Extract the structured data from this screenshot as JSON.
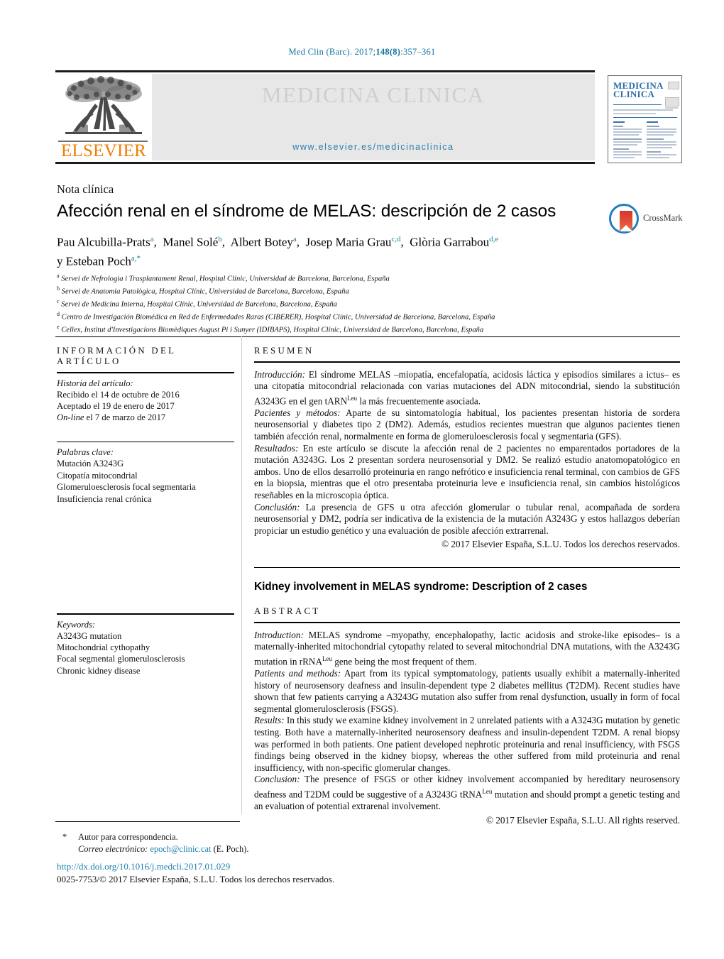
{
  "running_head": {
    "prefix": "Med Clin (Barc). 2017;",
    "volume_issue": "148(8)",
    "suffix": ":357–361"
  },
  "masthead": {
    "publisher": "ELSEVIER",
    "journal_title": "MEDICINA CLINICA",
    "journal_url": "www.elsevier.es/medicinaclinica",
    "cover_masthead_line1": "MEDICINA",
    "cover_masthead_line2": "CLINICA"
  },
  "article": {
    "type": "Nota clínica",
    "title": "Afección renal en el síndrome de MELAS: descripción de 2 casos",
    "crossmark_label": "CrossMark",
    "authors_line1_parts": [
      {
        "name": "Pau Alcubilla-Prats",
        "sup": "a"
      },
      {
        "name": "Manel Solé",
        "sup": "b"
      },
      {
        "name": "Albert Botey",
        "sup": "a"
      },
      {
        "name": "Josep Maria Grau",
        "sup": "c,d"
      },
      {
        "name": "Glòria Garrabou",
        "sup": "d,e"
      }
    ],
    "authors_line2": {
      "prefix": "y ",
      "name": "Esteban Poch",
      "sup": "a,*"
    },
    "affiliations": [
      {
        "marker": "a",
        "text": "Servei de Nefrologia i Trasplantament Renal, Hospital Clínic, Universidad de Barcelona, Barcelona, España"
      },
      {
        "marker": "b",
        "text": "Servei de Anatomia Patològica, Hospital Clínic, Universidad de Barcelona, Barcelona, España"
      },
      {
        "marker": "c",
        "text": "Servei de Medicina Interna, Hospital Clínic, Universidad de Barcelona, Barcelona, España"
      },
      {
        "marker": "d",
        "text": "Centro de Investigación Biomédica en Red de Enfermedades Raras (CIBERER), Hospital Clínic, Universidad de Barcelona, Barcelona, España"
      },
      {
        "marker": "e",
        "text": "Cellex, Institut d'Investigacions Biomèdiques August Pi i Sunyer (IDIBAPS), Hospital Clínic, Universidad de Barcelona, Barcelona, España"
      }
    ]
  },
  "info_column": {
    "heading": "INFORMACIÓN DEL ARTÍCULO",
    "history_label": "Historia del artículo:",
    "history": [
      "Recibido el 14 de octubre de 2016",
      "Aceptado el 19 de enero de 2017",
      "On-line el 7 de marzo de 2017"
    ],
    "history_online_italic": "On-line",
    "history_online_rest": " el 7 de marzo de 2017",
    "keywords_label": "Palabras clave:",
    "keywords": [
      "Mutación A3243G",
      "Citopatía mitocondrial",
      "Glomeruloesclerosis focal segmentaria",
      "Insuficiencia renal crónica"
    ],
    "keywords_en_label": "Keywords:",
    "keywords_en": [
      "A3243G mutation",
      "Mitochondrial cythopathy",
      "Focal segmental glomerulosclerosis",
      "Chronic kidney disease"
    ]
  },
  "abstract_es": {
    "heading": "RESUMEN",
    "sections": [
      {
        "label": "Introducción:",
        "text": " El síndrome MELAS –miopatía, encefalopatía, acidosis láctica y episodios similares a ictus– es una citopatía mitocondrial relacionada con varias mutaciones del ADN mitocondrial, siendo la substitución A3243G en el gen tARN",
        "sup": "Leu",
        "tail": " la más frecuentemente asociada."
      },
      {
        "label": "Pacientes y métodos:",
        "text": " Aparte de su sintomatología habitual, los pacientes presentan historia de sordera neurosensorial y diabetes tipo 2 (DM2). Además, estudios recientes muestran que algunos pacientes tienen también afección renal, normalmente en forma de glomeruloesclerosis focal y segmentaria (GFS).",
        "sup": "",
        "tail": ""
      },
      {
        "label": "Resultados:",
        "text": " En este artículo se discute la afección renal de 2 pacientes no emparentados portadores de la mutación A3243G. Los 2 presentan sordera neurosensorial y DM2. Se realizó estudio anatomopatológico en ambos. Uno de ellos desarrolló proteinuria en rango nefrótico e insuficiencia renal terminal, con cambios de GFS en la biopsia, mientras que el otro presentaba proteinuria leve e insuficiencia renal, sin cambios histológicos reseñables en la microscopia óptica.",
        "sup": "",
        "tail": ""
      },
      {
        "label": "Conclusión:",
        "text": " La presencia de GFS u otra afección glomerular o tubular renal, acompañada de sordera neurosensorial y DM2, podría ser indicativa de la existencia de la mutación A3243G y estos hallazgos deberían propiciar un estudio genético y una evaluación de posible afección extrarrenal.",
        "sup": "",
        "tail": ""
      }
    ],
    "copyright": "© 2017 Elsevier España, S.L.U. Todos los derechos reservados."
  },
  "abstract_en": {
    "title": "Kidney involvement in MELAS syndrome: Description of 2 cases",
    "heading": "ABSTRACT",
    "sections": [
      {
        "label": "Introduction:",
        "text": " MELAS syndrome –myopathy, encephalopathy, lactic acidosis and stroke-like episodes– is a maternally-inherited mitochondrial cytopathy related to several mitochondrial DNA mutations, with the A3243G mutation in rRNA",
        "sup": "Leu",
        "tail": " gene being the most frequent of them."
      },
      {
        "label": "Patients and methods:",
        "text": " Apart from its typical symptomatology, patients usually exhibit a maternally-inherited history of neurosensory deafness and insulin-dependent type 2 diabetes mellitus (T2DM). Recent studies have shown that few patients carrying a A3243G mutation also suffer from renal dysfunction, usually in form of focal segmental glomerulosclerosis (FSGS).",
        "sup": "",
        "tail": ""
      },
      {
        "label": "Results:",
        "text": " In this study we examine kidney involvement in 2 unrelated patients with a A3243G mutation by genetic testing. Both have a maternally-inherited neurosensory deafness and insulin-dependent T2DM. A renal biopsy was performed in both patients. One patient developed nephrotic proteinuria and renal insufficiency, with FSGS findings being observed in the kidney biopsy, whereas the other suffered from mild proteinuria and renal insufficiency, with non-specific glomerular changes.",
        "sup": "",
        "tail": ""
      },
      {
        "label": "Conclusion:",
        "text": " The presence of FSGS or other kidney involvement accompanied by hereditary neurosensory deafness and T2DM could be suggestive of a A3243G tRNA",
        "sup": "Leu",
        "tail": " mutation and should prompt a genetic testing and an evaluation of potential extrarenal involvement."
      }
    ],
    "copyright": "© 2017 Elsevier España, S.L.U. All rights reserved."
  },
  "footer": {
    "star": "*",
    "corresponding_author": "Autor para correspondencia.",
    "email_label": "Correo electrónico:",
    "email": "epoch@clinic.cat",
    "email_owner": " (E. Poch).",
    "doi": "http://dx.doi.org/10.1016/j.medcli.2017.01.029",
    "issn_line": "0025-7753/© 2017 Elsevier España, S.L.U. Todos los derechos reservados."
  },
  "colors": {
    "link": "#1e7fae",
    "elsevier_orange": "#f07d00",
    "crossmark_blue": "#1f7fc4",
    "crossmark_red": "#d8352a",
    "band_gray": "#e7e7e7"
  }
}
